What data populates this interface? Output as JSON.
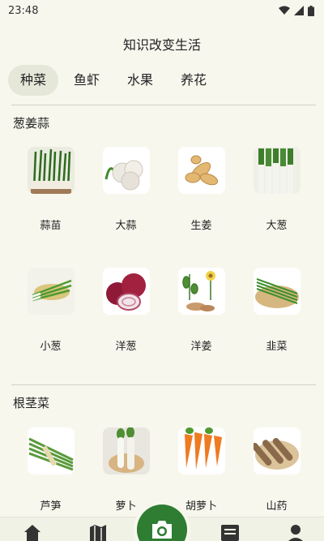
{
  "status_bar": {
    "time": "23:48"
  },
  "page_title": "知识改变生活",
  "tabs": [
    {
      "label": "种菜",
      "active": true
    },
    {
      "label": "鱼虾",
      "active": false
    },
    {
      "label": "水果",
      "active": false
    },
    {
      "label": "养花",
      "active": false
    }
  ],
  "sections": [
    {
      "title": "葱姜蒜",
      "items": [
        {
          "label": "蒜苗",
          "icon": "garlic-sprout"
        },
        {
          "label": "大蒜",
          "icon": "garlic"
        },
        {
          "label": "生姜",
          "icon": "ginger"
        },
        {
          "label": "大葱",
          "icon": "leek"
        },
        {
          "label": "小葱",
          "icon": "scallion"
        },
        {
          "label": "洋葱",
          "icon": "onion"
        },
        {
          "label": "洋姜",
          "icon": "jerusalem-artichoke"
        },
        {
          "label": "韭菜",
          "icon": "chive"
        }
      ]
    },
    {
      "title": "根茎菜",
      "items": [
        {
          "label": "芦笋",
          "icon": "asparagus"
        },
        {
          "label": "萝卜",
          "icon": "radish"
        },
        {
          "label": "胡萝卜",
          "icon": "carrot"
        },
        {
          "label": "山药",
          "icon": "yam"
        }
      ]
    }
  ],
  "bottom_nav": {
    "items": [
      "home-icon",
      "map-icon",
      "camera-icon",
      "message-icon",
      "profile-icon"
    ],
    "accent": "#2e7d32"
  }
}
